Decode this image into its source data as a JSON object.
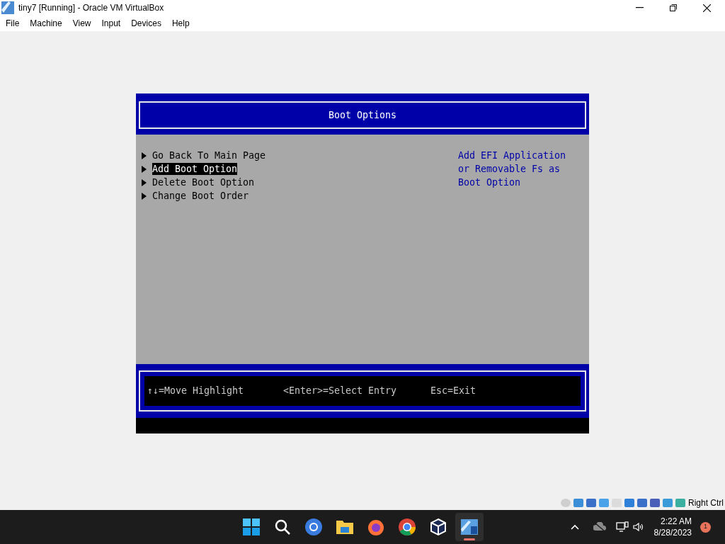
{
  "window": {
    "title": "tiny7 [Running] - Oracle VM VirtualBox"
  },
  "menu": [
    "File",
    "Machine",
    "View",
    "Input",
    "Devices",
    "Help"
  ],
  "vm_screen": {
    "title": "Boot Options",
    "items": [
      {
        "label": "Go Back To Main Page",
        "selected": false
      },
      {
        "label": "Add Boot Option",
        "selected": true
      },
      {
        "label": "Delete Boot Option",
        "selected": false
      },
      {
        "label": "Change Boot Order",
        "selected": false
      }
    ],
    "help_lines": [
      "Add EFI Application",
      "or Removable Fs as",
      "Boot Option"
    ],
    "hints": [
      "↑↓=Move Highlight",
      "<Enter>=Select Entry",
      "Esc=Exit"
    ]
  },
  "status_bar": {
    "host_key": "Right Ctrl"
  },
  "taskbar": {
    "apps": [
      {
        "kind": "start",
        "selected": false
      },
      {
        "kind": "search",
        "selected": false
      },
      {
        "kind": "browser-blue",
        "selected": false
      },
      {
        "kind": "folder",
        "selected": false
      },
      {
        "kind": "firefox",
        "selected": false
      },
      {
        "kind": "chrome",
        "selected": false
      },
      {
        "kind": "cube",
        "selected": false
      },
      {
        "kind": "vm",
        "selected": true
      }
    ],
    "time": "2:22 AM",
    "date": "8/28/2023",
    "notifications": "1"
  }
}
